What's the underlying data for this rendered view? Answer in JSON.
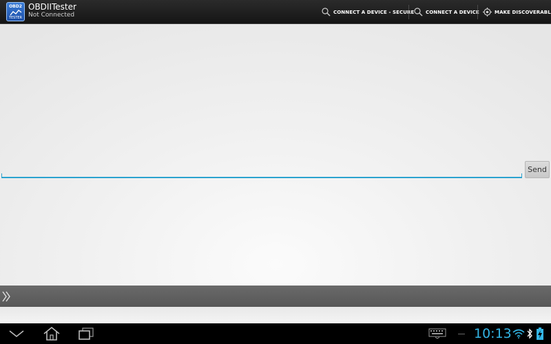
{
  "app": {
    "title": "OBDIITester",
    "status": "Not Connected",
    "logo_text_top": "OBD2",
    "logo_text_bottom": "TESTER",
    "icon": "app-logo-icon"
  },
  "menu": [
    {
      "label": "CONNECT A DEVICE - SECURE",
      "icon": "search-icon"
    },
    {
      "label": "CONNECT A DEVICE",
      "icon": "search-icon"
    },
    {
      "label": "MAKE DISCOVERABLE",
      "icon": "discoverable-icon"
    }
  ],
  "composer": {
    "value": "",
    "placeholder": "",
    "send_label": "Send"
  },
  "drawer": {
    "icon": "double-chevron-right-icon"
  },
  "system_bar": {
    "time": "10:13",
    "icons": [
      "back-icon",
      "home-icon",
      "recent-apps-icon",
      "keyboard-icon",
      "wifi-icon",
      "bluetooth-icon",
      "battery-icon"
    ]
  },
  "colors": {
    "accent": "#33b5e5",
    "input_underline": "#2aa2cf",
    "action_bar": "#1c1c1c",
    "drawer_bar": "#616161",
    "background": "#eeeeee"
  }
}
